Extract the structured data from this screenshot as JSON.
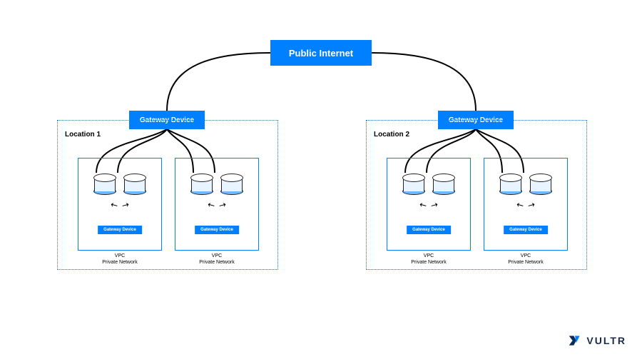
{
  "public_internet": "Public Internet",
  "gateways": {
    "left": "Gateway Device",
    "right": "Gateway Device"
  },
  "locations": {
    "left": {
      "label": "Location 1",
      "vpc_a": {
        "inner_label": "Gateway Device",
        "caption_l1": "VPC",
        "caption_l2": "Private Network"
      },
      "vpc_b": {
        "inner_label": "Gateway Device",
        "caption_l1": "VPC",
        "caption_l2": "Private Network"
      }
    },
    "right": {
      "label": "Location 2",
      "vpc_a": {
        "inner_label": "Gateway Device",
        "caption_l1": "VPC",
        "caption_l2": "Private Network"
      },
      "vpc_b": {
        "inner_label": "Gateway Device",
        "caption_l1": "VPC",
        "caption_l2": "Private Network"
      }
    }
  },
  "logo_text": "VULTR",
  "colors": {
    "accent": "#0080ff"
  }
}
